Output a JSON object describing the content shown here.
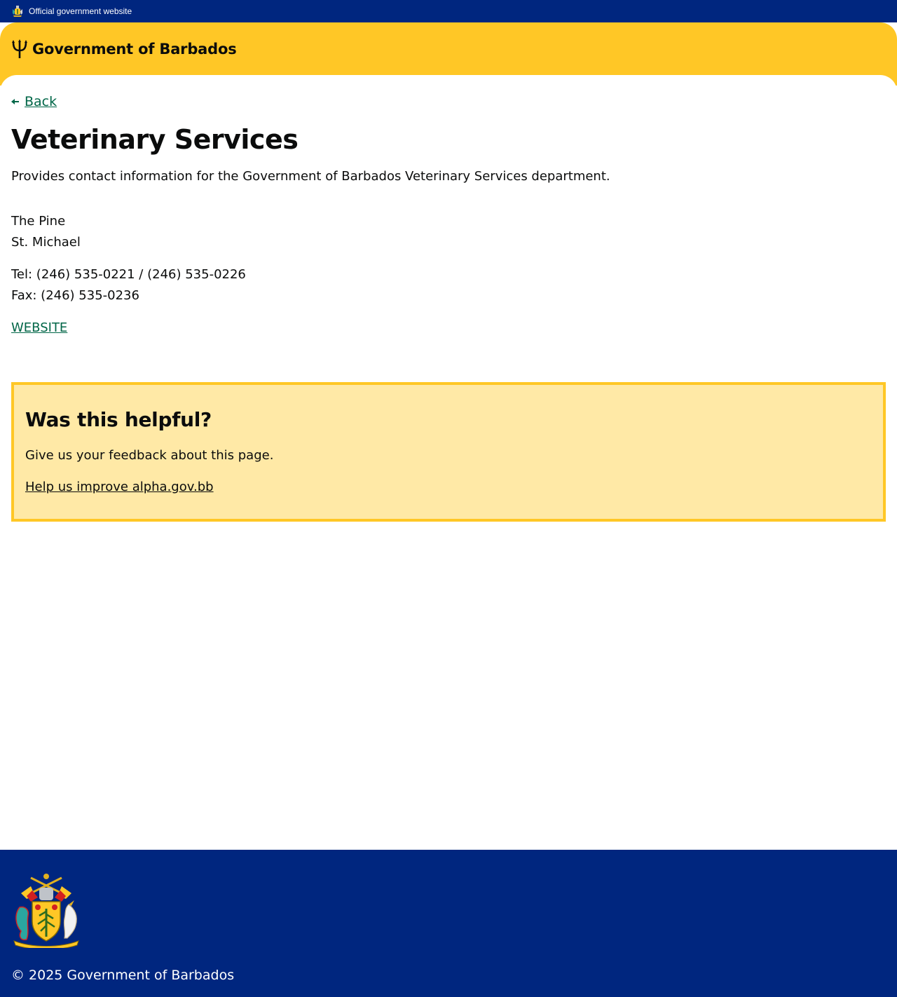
{
  "official_bar": {
    "text": "Official government website",
    "crest_icon": "coat-of-arms-icon"
  },
  "header": {
    "logo_icon": "trident-icon",
    "title": "Government of Barbados"
  },
  "main": {
    "back_label": "Back",
    "title": "Veterinary Services",
    "summary": "Provides contact information for the Government of Barbados Veterinary Services department.",
    "address": [
      "The Pine",
      "St. Michael"
    ],
    "tel": "Tel: (246) 535-0221 / (246) 535-0226",
    "fax": "Fax: (246) 535-0236",
    "website_label": "WEBSITE"
  },
  "feedback": {
    "heading": "Was this helpful?",
    "text": "Give us your feedback about this page.",
    "link_label": "Help us improve alpha.gov.bb"
  },
  "footer": {
    "copyright": "© 2025 Government of Barbados",
    "crest_icon": "coat-of-arms-icon"
  },
  "colors": {
    "navy": "#00267f",
    "gold": "#ffc726",
    "pale_gold": "#ffe9a6",
    "link_green": "#006647"
  }
}
